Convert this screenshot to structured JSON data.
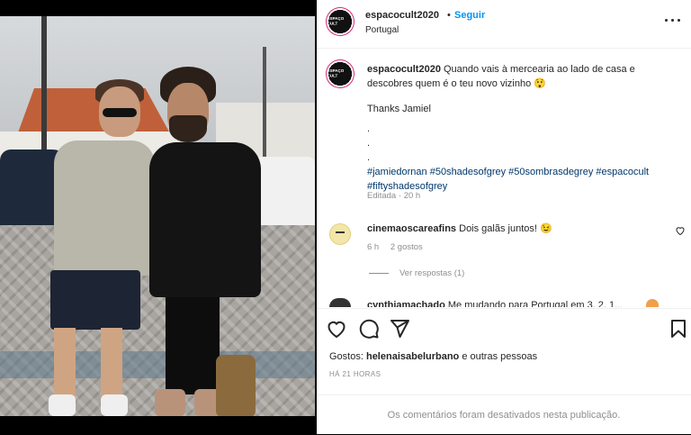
{
  "header": {
    "username": "espacocult2020",
    "separator": "•",
    "follow_label": "Seguir",
    "location": "Portugal",
    "avatar_text": "ESPAÇO CULT"
  },
  "caption": {
    "username": "espacocult2020",
    "text": "Quando vais à mercearia ao lado de casa e descobres quem é o teu novo vizinho",
    "emoji": "😲",
    "thanks": "Thanks Jamiel",
    "dots": [
      ".",
      ".",
      "."
    ],
    "hashtags": "#jamiedornan #50shadesofgrey #50sombrasdegrey #espacocult #fiftyshadesofgrey",
    "edited_label": "Editada",
    "edited_sep": "·",
    "edited_time": "20 h"
  },
  "comments": [
    {
      "username": "cinemaoscareafins",
      "text": "Dois galãs juntos!",
      "emoji": "😉",
      "time": "6 h",
      "likes": "2 gostos",
      "replies_label": "Ver respostas (1)"
    },
    {
      "username": "cynthiamachado",
      "text": "Me mudando para Portugal em 3, 2, 1..."
    }
  ],
  "actions": {
    "likes_prefix": "Gostos:",
    "likes_user": "helenaisabelurbano",
    "likes_suffix": "e outras pessoas",
    "time_ago": "HÁ 21 HORAS"
  },
  "footer": {
    "comments_disabled": "Os comentários foram desativados nesta publicação."
  },
  "icons": {
    "like": "heart-icon",
    "comment": "comment-icon",
    "share": "share-icon",
    "save": "bookmark-icon",
    "more": "more-options-icon"
  },
  "colors": {
    "link_blue": "#0095f6",
    "hashtag": "#00376b",
    "muted": "#8e8e8e",
    "text": "#262626"
  }
}
